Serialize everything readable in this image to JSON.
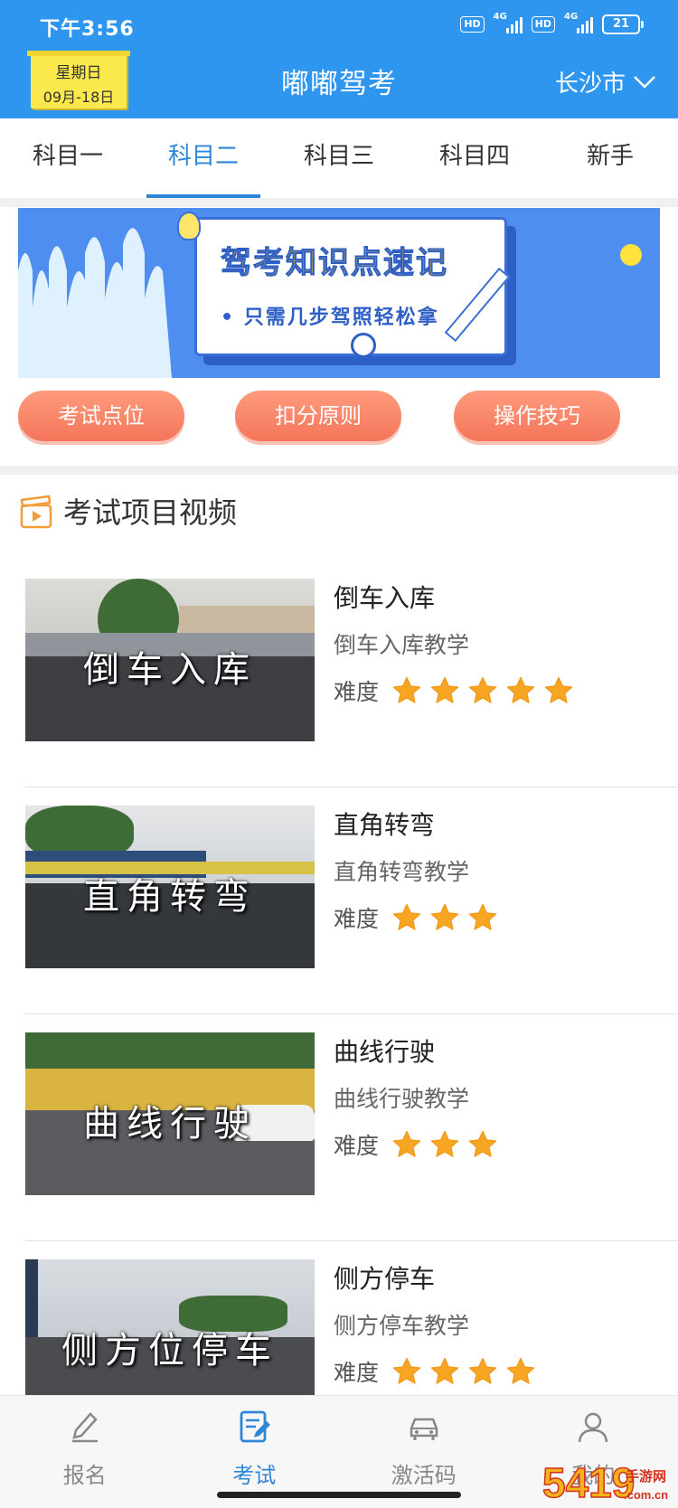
{
  "status_bar": {
    "time": "下午3:56",
    "hd1": "HD",
    "net1": "4G",
    "hd2": "HD",
    "net2": "4G",
    "battery": "21"
  },
  "header": {
    "calendar_week": "星期日",
    "calendar_date": "09月-18日",
    "title": "嘟嘟驾考",
    "city": "长沙市",
    "city_icon": "chevron-down-icon",
    "color": "#2f96ef"
  },
  "tabs": [
    {
      "label": "科目一",
      "active": false
    },
    {
      "label": "科目二",
      "active": true
    },
    {
      "label": "科目三",
      "active": false
    },
    {
      "label": "科目四",
      "active": false
    },
    {
      "label": "新手",
      "active": false
    }
  ],
  "banner": {
    "title": "驾考知识点速记",
    "subtitle": "• 只需几步驾照轻松拿"
  },
  "quick_buttons": [
    "考试点位",
    "扣分原则",
    "操作技巧"
  ],
  "section": {
    "title": "考试项目视频",
    "icon": "video-clapper-icon"
  },
  "videos": [
    {
      "thumb_text": "倒车入库",
      "title": "倒车入库",
      "subtitle": "倒车入库教学",
      "difficulty_label": "难度",
      "difficulty": 5
    },
    {
      "thumb_text": "直角转弯",
      "title": "直角转弯",
      "subtitle": "直角转弯教学",
      "difficulty_label": "难度",
      "difficulty": 3
    },
    {
      "thumb_text": "曲线行驶",
      "title": "曲线行驶",
      "subtitle": "曲线行驶教学",
      "difficulty_label": "难度",
      "difficulty": 3
    },
    {
      "thumb_text": "侧方位停车",
      "title": "侧方停车",
      "subtitle": "侧方停车教学",
      "difficulty_label": "难度",
      "difficulty": 4
    }
  ],
  "bottom_nav": [
    {
      "label": "报名",
      "icon": "pen-icon",
      "active": false
    },
    {
      "label": "考试",
      "icon": "exam-paper-icon",
      "active": true
    },
    {
      "label": "激活码",
      "icon": "car-icon",
      "active": false
    },
    {
      "label": "我的",
      "icon": "user-icon",
      "active": false
    }
  ],
  "watermark": {
    "text": "5419",
    "site": "手游网",
    "domain": ".com.cn"
  }
}
